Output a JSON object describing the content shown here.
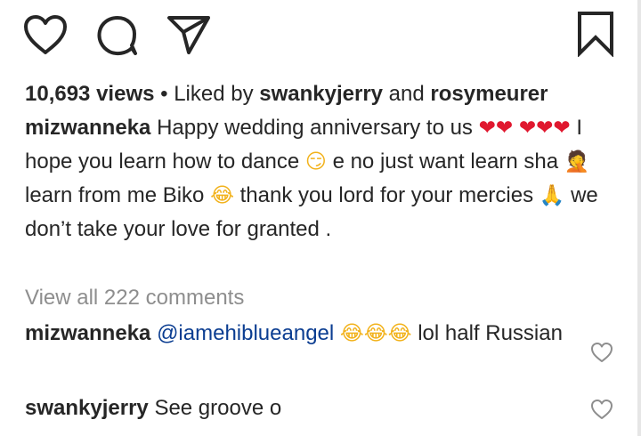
{
  "post": {
    "views": "10,693 views",
    "separator": " • Liked by ",
    "liked_by_1": "swankyjerry",
    "and": " and ",
    "liked_by_2": "rosymeurer"
  },
  "caption": {
    "username": "mizwanneka",
    "text_1": "Happy wedding anniversary to us",
    "text_2": "I hope you learn how to dance",
    "text_3": "e no just want learn sha",
    "text_4": "learn from me Biko",
    "text_5": "thank you lord for your mercies",
    "text_6": "we don’t take your love for granted ."
  },
  "emojis": {
    "heart": "❤",
    "smirk": "😏",
    "facepalm": "🤦",
    "joy": "😂",
    "pray": "🙏"
  },
  "view_all": "View all 222 comments",
  "comments": [
    {
      "username": "mizwanneka",
      "mention": "@iamehiblueangel",
      "text": "lol half Russian"
    },
    {
      "username": "swankyjerry",
      "text": "See groove o"
    }
  ],
  "icons": {
    "top": [
      "heart-icon",
      "comment-icon",
      "share-icon",
      "bookmark-icon"
    ],
    "comment_like": "heart-icon"
  },
  "colors": {
    "text": "#262626",
    "muted": "#8e8e8e",
    "mention": "#0b3d91",
    "emoji_heart": "#e0182f"
  }
}
